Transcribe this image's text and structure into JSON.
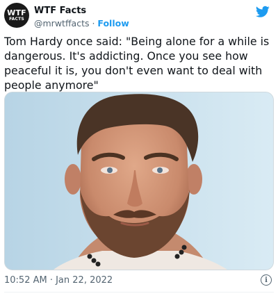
{
  "author": {
    "avatar_line1": "WTF",
    "avatar_line2": "FACTS",
    "name": "WTF Facts",
    "handle": "@mrwtffacts",
    "separator": " · ",
    "follow_label": "Follow"
  },
  "tweet": {
    "text": "Tom Hardy once said: \"Being alone for a while is dangerous. It's addicting. Once you see how peaceful it is, you don't even want to deal with people anymore\"",
    "timestamp": "10:52 AM · Jan 22, 2022",
    "media_subject": "portrait photo of a bearded man"
  },
  "icons": {
    "brand": "twitter-bird-icon",
    "info": "info-icon"
  },
  "colors": {
    "accent": "#1d9bf0",
    "text": "#0f1419",
    "secondary_text": "#536471",
    "photo_background": "#cde4ef"
  }
}
